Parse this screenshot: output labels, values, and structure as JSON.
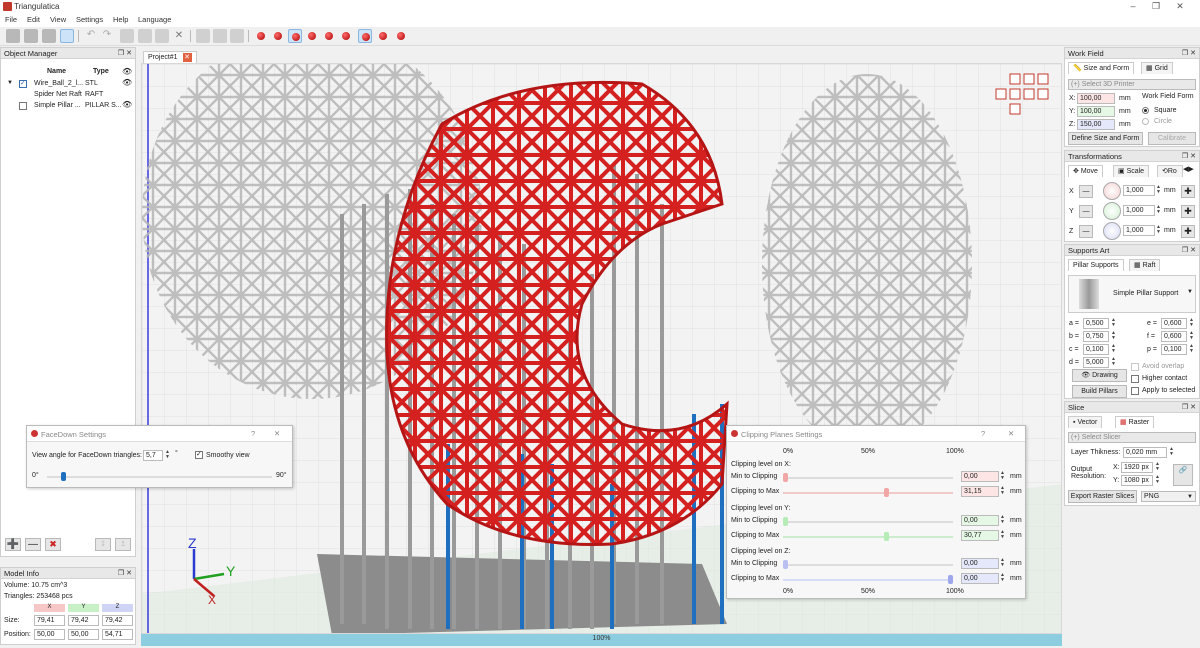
{
  "app": {
    "title": "Triangulatica"
  },
  "menu": [
    "File",
    "Edit",
    "View",
    "Settings",
    "Help",
    "Language"
  ],
  "object_manager": {
    "title": "Object Manager",
    "columns": [
      "Name",
      "Type"
    ],
    "rows": [
      {
        "name": "Wire_Ball_2_l...",
        "type": "STL"
      },
      {
        "name": "Spider Net Raft",
        "type": "RAFT"
      },
      {
        "name": "Simple Pillar ...",
        "type": "PILLAR S..."
      }
    ]
  },
  "model_info": {
    "title": "Model Info",
    "volume": "Volume: 10.75 cm^3",
    "triangles": "Triangles: 253468 pcs",
    "axes": [
      "X",
      "Y",
      "Z"
    ],
    "size_label": "Size:",
    "size": [
      "79,41",
      "79,42",
      "79,42"
    ],
    "position_label": "Position:",
    "position": [
      "50,00",
      "50,00",
      "54,71"
    ]
  },
  "project_tab": {
    "label": "Project#1"
  },
  "viewport": {
    "zoom": "100%"
  },
  "axes_gizmo": {
    "x": "X",
    "y": "Y",
    "z": "Z"
  },
  "facedown": {
    "title": "FaceDown Settings",
    "help": "?",
    "close": "✕",
    "angle_label": "View angle for FaceDown triangles:",
    "angle_value": "5,7",
    "degree": "°",
    "smooth_label": "Smoothy view",
    "min": "0°",
    "max": "90°",
    "slider_fraction": 0.063
  },
  "clipping": {
    "title": "Clipping Planes Settings",
    "help": "?",
    "close": "✕",
    "scale": [
      "0%",
      "50%",
      "100%"
    ],
    "unit": "mm",
    "x_title": "Clipping level on X:",
    "y_title": "Clipping level on Y:",
    "z_title": "Clipping level on Z:",
    "min_label": "Min to Clipping",
    "max_label": "Clipping to Max",
    "x_min": "0,00",
    "x_max": "31,15",
    "y_min": "0,00",
    "y_max": "30,77",
    "z_min": "0,00",
    "z_max": "0,00",
    "x_max_fraction": 0.61,
    "y_max_fraction": 0.61,
    "z_max_fraction": 1.0
  },
  "work_field": {
    "title": "Work Field",
    "tab_size": "Size and Form",
    "tab_grid": "Grid",
    "printer_select": "(+) Select 3D Printer",
    "x": "100,00",
    "y": "100,00",
    "z": "150,00",
    "x_label": "X:",
    "y_label": "Y:",
    "z_label": "Z:",
    "unit": "mm",
    "form_label": "Work Field Form",
    "square": "Square",
    "circle": "Circle",
    "define_btn": "Define Size and Form",
    "calibrate_btn": "Calibrate"
  },
  "transformations": {
    "title": "Transformations",
    "tab_move": "Move",
    "tab_scale": "Scale",
    "tab_rotate": "Ro",
    "x": "1,000",
    "y": "1,000",
    "z": "1,000",
    "unit": "mm"
  },
  "supports": {
    "title": "Supports Art",
    "tab_pillar": "Pillar Supports",
    "tab_raft": "Raft",
    "support_type": "Simple Pillar Support",
    "params_left": [
      {
        "label": "a =",
        "value": "0,500"
      },
      {
        "label": "b =",
        "value": "0,750"
      },
      {
        "label": "c =",
        "value": "0,100"
      },
      {
        "label": "d =",
        "value": "5,000"
      }
    ],
    "params_right": [
      {
        "label": "e =",
        "value": "0,600"
      },
      {
        "label": "f =",
        "value": "0,600"
      },
      {
        "label": "p =",
        "value": "0,100"
      }
    ],
    "avoid_overlap": "Avoid overlap",
    "drawing_btn": "Drawing",
    "higher_contact": "Higher contact",
    "build_btn": "Build Pillars",
    "apply_selected": "Apply to selected"
  },
  "slice": {
    "title": "Slice",
    "tab_vector": "Vector",
    "tab_raster": "Raster",
    "slicer_select": "(+) Select Slicer",
    "layer_label": "Layer Thikness:",
    "layer_value": "0,020 mm",
    "output_label": "Output",
    "resolution_label": "Resolution:",
    "x_label": "X:",
    "y_label": "Y:",
    "res_x": "1920 px",
    "res_y": "1080 px",
    "export_btn": "Export Raster Slices",
    "format": "PNG"
  },
  "colors": {
    "accent_red": "#d52020",
    "support_grey": "#9a9a9a",
    "support_blue": "#1e6fc0"
  }
}
